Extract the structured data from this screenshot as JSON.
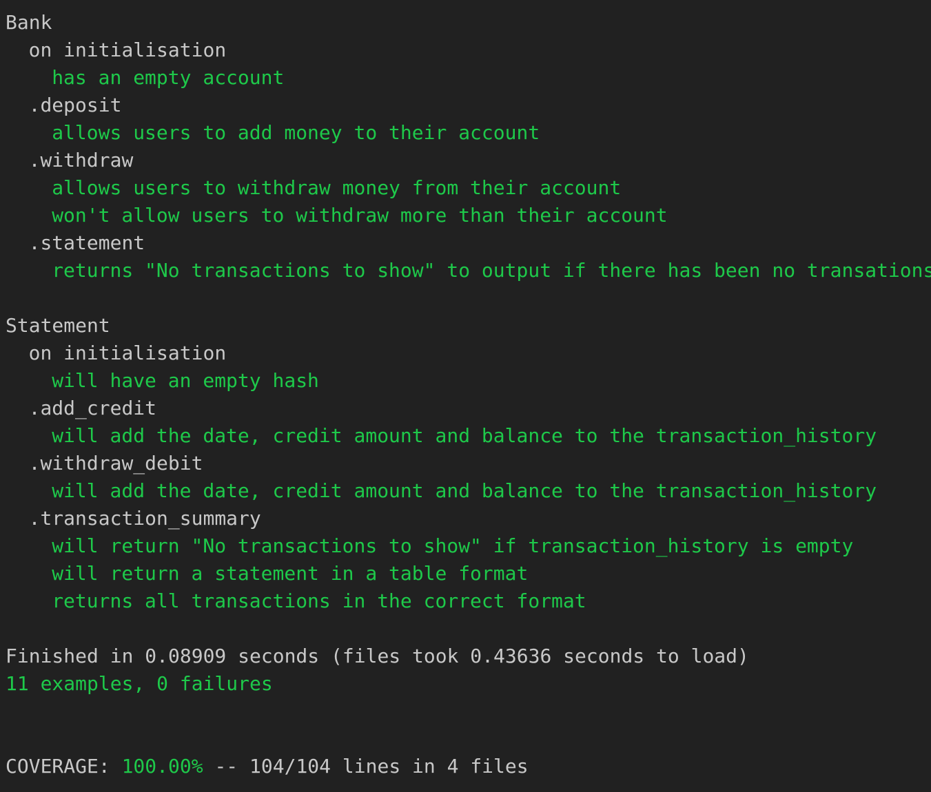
{
  "colors": {
    "background": "#212121",
    "text": "#c8c8c8",
    "pass": "#1ec94a"
  },
  "groups": [
    {
      "name": "Bank",
      "contexts": [
        {
          "label": "on initialisation",
          "examples": [
            "has an empty account"
          ]
        },
        {
          "label": ".deposit",
          "examples": [
            "allows users to add money to their account"
          ]
        },
        {
          "label": ".withdraw",
          "examples": [
            "allows users to withdraw money from their account",
            "won't allow users to withdraw more than their account"
          ]
        },
        {
          "label": ".statement",
          "examples": [
            "returns \"No transactions to show\" to output if there has been no transations"
          ]
        }
      ]
    },
    {
      "name": "Statement",
      "contexts": [
        {
          "label": "on initialisation",
          "examples": [
            "will have an empty hash"
          ]
        },
        {
          "label": ".add_credit",
          "examples": [
            "will add the date, credit amount and balance to the transaction_history"
          ]
        },
        {
          "label": ".withdraw_debit",
          "examples": [
            "will add the date, credit amount and balance to the transaction_history"
          ]
        },
        {
          "label": ".transaction_summary",
          "examples": [
            "will return \"No transactions to show\" if transaction_history is empty",
            "will return a statement in a table format",
            "returns all transactions in the correct format"
          ]
        }
      ]
    }
  ],
  "summary": {
    "finished": "Finished in 0.08909 seconds (files took 0.43636 seconds to load)",
    "result": "11 examples, 0 failures"
  },
  "coverage": {
    "label": "COVERAGE: ",
    "percent": "100.00%",
    "detail": " -- 104/104 lines in 4 files"
  }
}
